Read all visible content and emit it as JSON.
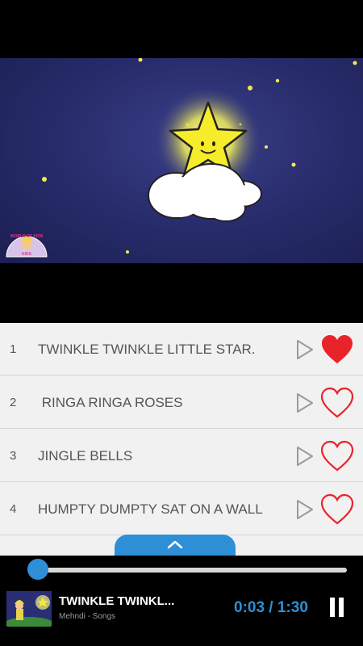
{
  "video": {
    "logo_text": "WORLD OF KIDS",
    "logo_subtext": "KIDS"
  },
  "playlist": [
    {
      "number": "1",
      "title": "TWINKLE TWINKLE LITTLE STAR.",
      "favorite": true
    },
    {
      "number": "2",
      "title": " RINGA RINGA ROSES",
      "favorite": false
    },
    {
      "number": "3",
      "title": "JINGLE BELLS",
      "favorite": false
    },
    {
      "number": "4",
      "title": "HUMPTY DUMPTY SAT ON A WALL",
      "favorite": false
    }
  ],
  "player": {
    "now_playing_title": "TWINKLE TWINKL...",
    "now_playing_subtitle": "Mehndi - Songs",
    "time": "0:03 / 1:30",
    "progress": 0.033
  },
  "icons": {
    "play": "play-outline-icon",
    "favorite_on": "heart-filled-icon",
    "favorite_off": "heart-outline-icon",
    "expand": "chevron-up-icon",
    "pause": "pause-icon"
  },
  "colors": {
    "accent": "#2e8fd6",
    "heart": "#e8242a",
    "video_bg": "#262a68"
  }
}
